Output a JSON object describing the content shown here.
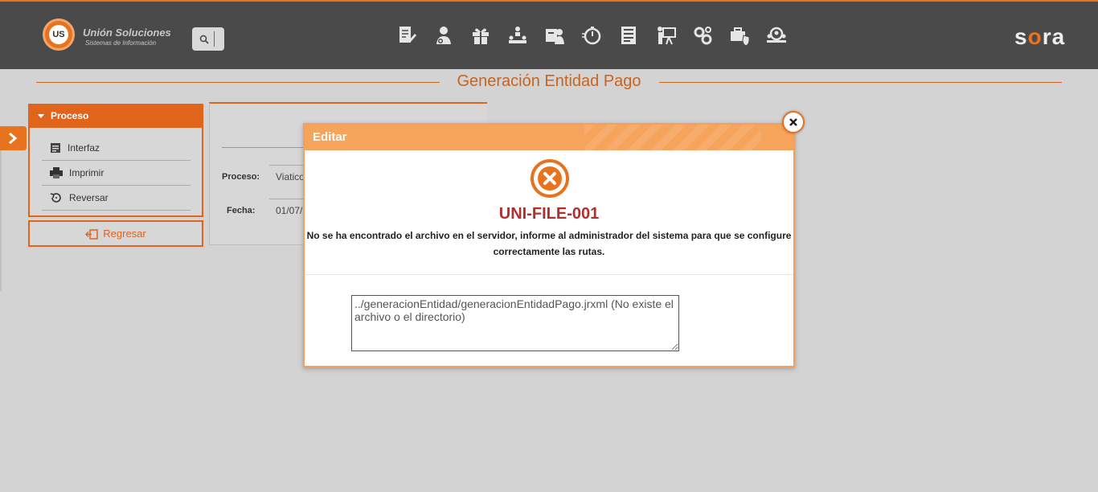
{
  "header": {
    "logo_title": "Unión Soluciones",
    "logo_subtitle": "Sistemas de Información",
    "logo_badge": "US",
    "brand_left": "s",
    "brand_mid": "a",
    "brand_pre": "o",
    "brand_right": "ra",
    "nav_icons": [
      "document-edit-icon",
      "user-icon",
      "gift-icon",
      "hierarchy-icon",
      "id-card-icon",
      "stopwatch-icon",
      "form-icon",
      "presentation-icon",
      "gears-icon",
      "briefcase-shield-icon",
      "magnifier-users-icon"
    ]
  },
  "page": {
    "title": "Generación Entidad Pago"
  },
  "sidebar": {
    "section_title": "Proceso",
    "items": [
      {
        "label": "Interfaz",
        "icon": "document-icon"
      },
      {
        "label": "Imprimir",
        "icon": "printer-icon"
      },
      {
        "label": "Reversar",
        "icon": "undo-icon"
      }
    ],
    "back_label": "Regresar"
  },
  "form": {
    "process_label": "Proceso:",
    "process_value": "Viatico",
    "date_label": "Fecha:",
    "date_value": "01/07/"
  },
  "modal": {
    "title": "Editar",
    "error_code": "UNI-FILE-001",
    "message": "No se ha encontrado el archivo en el servidor, informe al administrador del sistema para que se configure correctamente las rutas.",
    "detail": "../generacionEntidad/generacionEntidadPago.jrxml (No existe el archivo o el directorio)"
  },
  "colors": {
    "accent": "#e0641a",
    "header_bg": "#4a4a4a",
    "error": "#b03030"
  }
}
